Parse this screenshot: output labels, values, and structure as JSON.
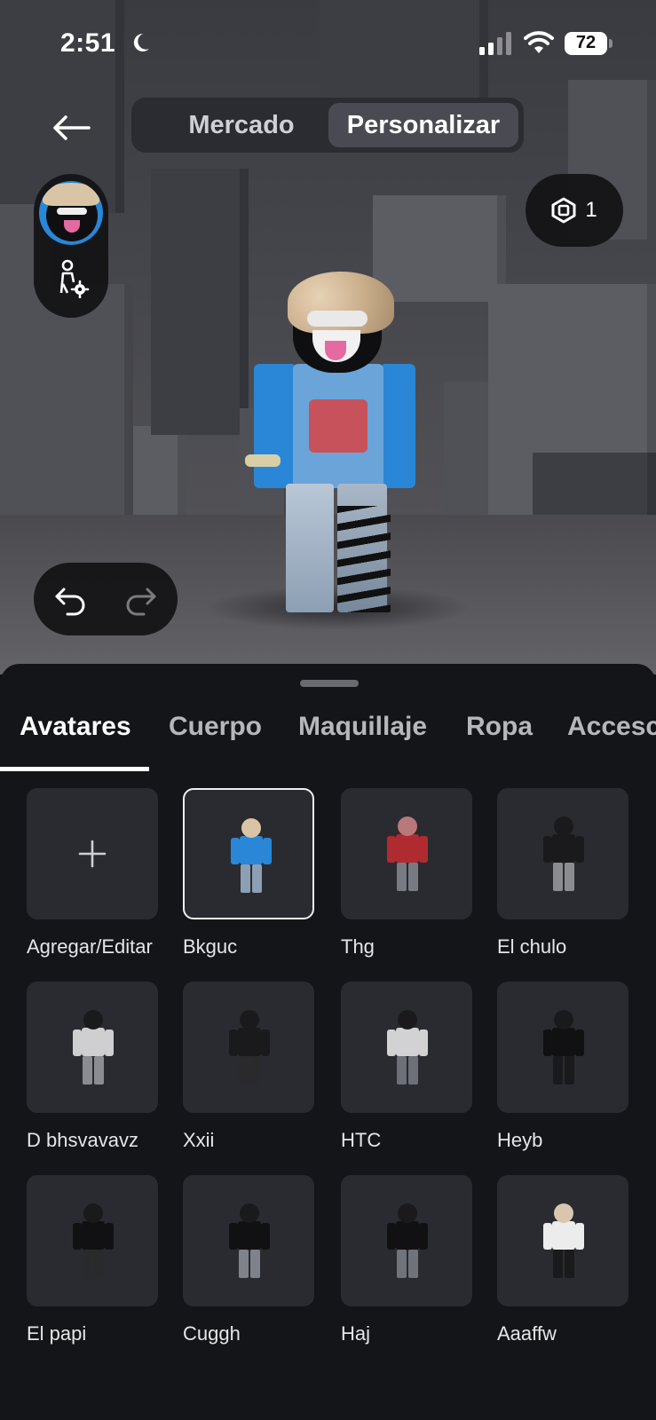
{
  "status_bar": {
    "time": "2:51",
    "battery": "72"
  },
  "nav": {
    "tabs": [
      {
        "label": "Mercado"
      },
      {
        "label": "Personalizar"
      }
    ],
    "active": "Personalizar"
  },
  "robux": {
    "amount": "1"
  },
  "categories": {
    "tabs": [
      {
        "label": "Avatares"
      },
      {
        "label": "Cuerpo"
      },
      {
        "label": "Maquillaje"
      },
      {
        "label": "Ropa"
      },
      {
        "label": "Accesc"
      }
    ],
    "active": "Avatares"
  },
  "avatars": [
    {
      "name": "Agregar/Editar",
      "kind": "add",
      "icon": "plus-icon"
    },
    {
      "name": "Bkguc",
      "selected": true,
      "colors": {
        "head": "#d9c5a6",
        "torso": "#2a86d6",
        "legs": "#8d9fb3"
      }
    },
    {
      "name": "Thg",
      "colors": {
        "head": "#b9787a",
        "torso": "#b02b2f",
        "legs": "#777b82"
      }
    },
    {
      "name": "El chulo",
      "colors": {
        "head": "#1a1a1d",
        "torso": "#1a1a1d",
        "legs": "#8a8c90"
      }
    },
    {
      "name": "D bhsvavavz",
      "colors": {
        "head": "#1a1a1d",
        "torso": "#cfcfd2",
        "legs": "#8a8c90"
      }
    },
    {
      "name": "Xxii",
      "colors": {
        "head": "#1a1a1d",
        "torso": "#1a1a1d",
        "legs": "#2a2a2d"
      }
    },
    {
      "name": "HTC",
      "colors": {
        "head": "#1a1a1d",
        "torso": "#d2d2d5",
        "legs": "#6d7078"
      }
    },
    {
      "name": "Heyb",
      "colors": {
        "head": "#1a1a1d",
        "torso": "#111113",
        "legs": "#1a1a1d"
      }
    },
    {
      "name": "El papi",
      "colors": {
        "head": "#1a1a1d",
        "torso": "#111113",
        "legs": "#2a2a2d"
      }
    },
    {
      "name": "Cuggh",
      "colors": {
        "head": "#1a1a1d",
        "torso": "#111113",
        "legs": "#7e838b"
      }
    },
    {
      "name": "Haj",
      "colors": {
        "head": "#1a1a1d",
        "torso": "#111113",
        "legs": "#6f747c"
      }
    },
    {
      "name": "Aaaffw",
      "colors": {
        "head": "#d8c6ae",
        "torso": "#ececec",
        "legs": "#1a1a1d"
      }
    }
  ]
}
